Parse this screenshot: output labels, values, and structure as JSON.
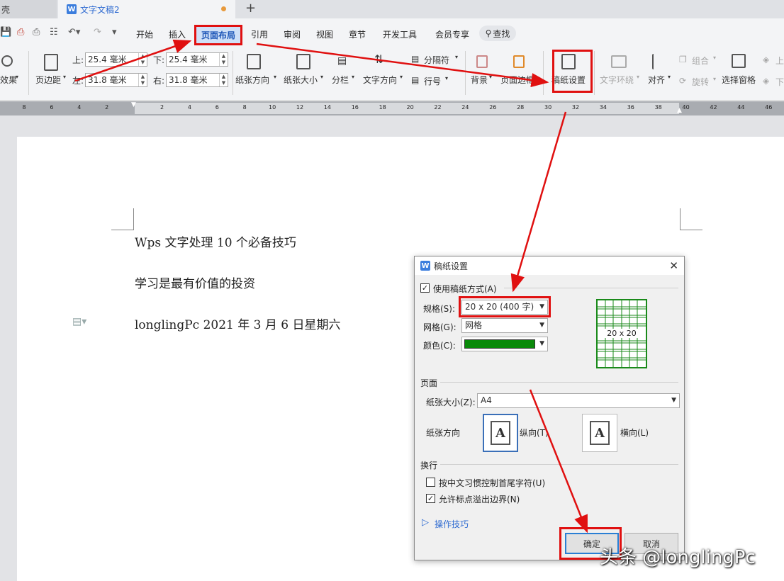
{
  "tabs": {
    "prev": "壳",
    "doc": "文字文稿2",
    "new": "+"
  },
  "menu": {
    "start": "开始",
    "insert": "插入",
    "layout": "页面布局",
    "reference": "引用",
    "review": "审阅",
    "view": "视图",
    "section": "章节",
    "devtools": "开发工具",
    "member": "会员专享",
    "search": "查找"
  },
  "ribbon": {
    "effect": "效果",
    "margins": "页边距",
    "top_label": "上:",
    "top_value": "25.4 毫米",
    "bottom_label": "下:",
    "bottom_value": "25.4 毫米",
    "left_label": "左:",
    "left_value": "31.8 毫米",
    "right_label": "右:",
    "right_value": "31.8 毫米",
    "orientation": "纸张方向",
    "size": "纸张大小",
    "columns": "分栏",
    "text_direction": "文字方向",
    "separator": "分隔符",
    "line_numbers": "行号",
    "background": "背景",
    "page_border": "页面边框",
    "manuscript": "稿纸设置",
    "text_wrap": "文字环绕",
    "align": "对齐",
    "group": "组合",
    "rotate": "旋转",
    "selection_pane": "选择窗格",
    "up": "上",
    "down": "下"
  },
  "ruler_ticks": [
    "8",
    "6",
    "4",
    "2",
    "",
    "2",
    "4",
    "6",
    "8",
    "10",
    "12",
    "14",
    "16",
    "18",
    "20",
    "22",
    "24",
    "26",
    "28",
    "30",
    "32",
    "34",
    "36",
    "38",
    "40",
    "42",
    "44",
    "46"
  ],
  "document": {
    "line1": "Wps  文字处理 10 个必备技巧",
    "line2": "学习是最有价值的投资",
    "line3": "longlingPc    2021 年 3 月 6 日星期六"
  },
  "dialog": {
    "title": "稿纸设置",
    "use_manuscript": "使用稿纸方式(A)",
    "spec_label": "规格(S):",
    "spec_value": "20 x 20 (400 字)",
    "grid_label": "网格(G):",
    "grid_value": "网格",
    "color_label": "颜色(C):",
    "color_value": "#0a8a0a",
    "preview_label": "20 x 20",
    "page_section": "页面",
    "paper_size_label": "纸张大小(Z):",
    "paper_size_value": "A4",
    "orientation_label": "纸张方向",
    "portrait": "纵向(T)",
    "landscape": "横向(L)",
    "wrap_section": "换行",
    "opt1": "按中文习惯控制首尾字符(U)",
    "opt2": "允许标点溢出边界(N)",
    "tips": "操作技巧",
    "ok": "确定",
    "cancel": "取消"
  },
  "watermark": "头条 @longlingPc",
  "colors": {
    "annotation": "#e01010",
    "accent": "#2f6bd1"
  }
}
